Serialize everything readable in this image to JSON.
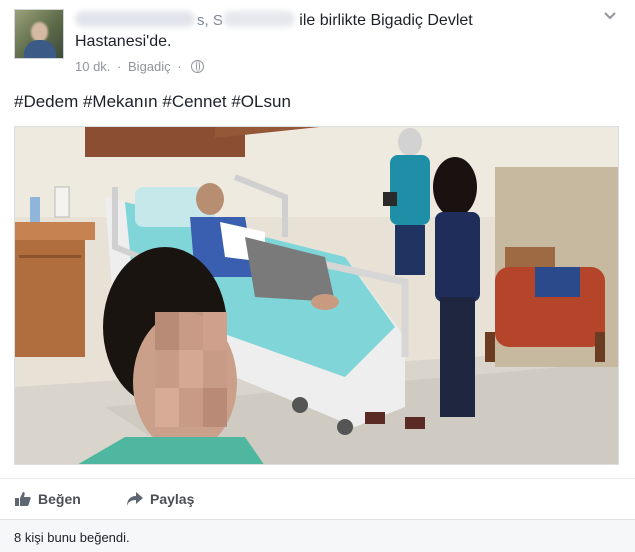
{
  "post": {
    "header": {
      "name_fragment": "s, S",
      "with_text": "ile birlikte",
      "place_line1": "Bigadiç Devlet",
      "place_line2": "Hastanesi'de."
    },
    "meta": {
      "time": "10 dk.",
      "separator": "·",
      "location": "Bigadiç",
      "privacy_icon": "globe-icon"
    },
    "text": "#Dedem #Mekanın #Cennet #OLsun",
    "photo": {
      "description_icon": "hospital-photo"
    },
    "actions": {
      "like_label": "Beğen",
      "share_label": "Paylaş"
    },
    "likes": {
      "summary": "8 kişi bunu beğendi."
    },
    "colors": {
      "link": "#365899",
      "meta": "#90949c",
      "action": "#4b4f56",
      "likes_bg": "#f6f7f9"
    }
  }
}
